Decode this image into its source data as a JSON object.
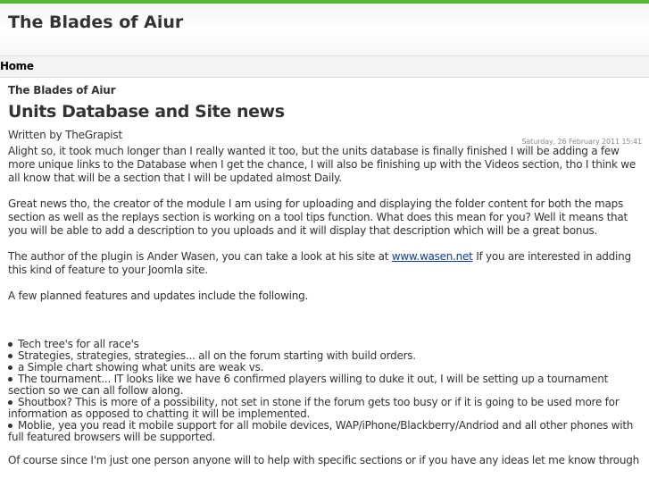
{
  "site": {
    "title": "The Blades of Aiur",
    "accent_color": "#52b733"
  },
  "nav": {
    "home_label": "Home"
  },
  "article": {
    "section": "The Blades of Aiur",
    "title": "Units Database and Site news",
    "author": "Written by TheGrapist",
    "date": "Saturday, 26 February 2011 15:41",
    "paragraphs": [
      "Alight so, it took much longer than I really wanted it too, but the units database is finally finished I will be adding a few more unique links to the Database when I get the chance, I will also be finishing up with the Videos section, tho I think we all know that will be a section that I will be updated almost Daily.",
      "Great news tho, the creator of the module I am using for uploading and displaying the folder content for both the maps section as well as the replays section is working on a tool tips function. What does this mean for you? Well it means that you will be able to add a description to you uploads and it will display that description which will be a great bonus."
    ],
    "plugin_para": {
      "before_link": "The author of the plugin is Ander Wasen, you can take a look at his site at ",
      "link_text": "www.wasen.net",
      "after_link": " If you are interested in adding this kind of feature to your Joomla site."
    },
    "features_intro": "A few planned features and updates include the following.",
    "features": [
      "Tech tree's for all race's",
      "Strategies, strategies, strategies... all on the forum starting with build orders.",
      "a Simple chart showing what units are weak vs.",
      "The tournament... IT looks like we have 6 confirmed players willing to duke it out, I will be setting up a tournament section so we can all follow along.",
      "Shoutbox? This is more of a possibility, not set in stone if the forum gets too busy or if it is going to be used more for information as opposed to chatting it will be implemented.",
      "Moblie, yea you read it mobile support for all mobile devices, WAP/iPhone/Blackberry/Andriod and all other phones with full featured browsers will be supported."
    ],
    "closing": "Of course since I'm just one person anyone will to help with specific sections or if you have any ideas let me know through"
  }
}
